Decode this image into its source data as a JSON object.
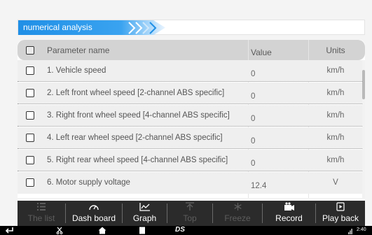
{
  "title": {
    "text": "numerical analysis",
    "accent_color": "#1f8fe6"
  },
  "table": {
    "headers": {
      "name": "Parameter name",
      "value": "Value",
      "units": "Units"
    },
    "rows": [
      {
        "name": "1. Vehicle speed",
        "value": "0",
        "unit": "km/h",
        "checked": false
      },
      {
        "name": "2. Left front wheel speed [2-channel ABS specific]",
        "value": "0",
        "unit": "km/h",
        "checked": false
      },
      {
        "name": "3. Right front wheel speed [4-channel ABS specific]",
        "value": "0",
        "unit": "km/h",
        "checked": false
      },
      {
        "name": "4. Left rear wheel speed [2-channel ABS specific]",
        "value": "0",
        "unit": "km/h",
        "checked": false
      },
      {
        "name": "5. Right rear wheel speed [4-channel ABS specific]",
        "value": "0",
        "unit": "km/h",
        "checked": false
      },
      {
        "name": "6. Motor supply voltage",
        "value": "12.4",
        "unit": "V",
        "checked": false
      }
    ]
  },
  "toolbar": {
    "buttons": [
      {
        "label": "The list",
        "icon": "list-icon",
        "enabled": false
      },
      {
        "label": "Dash board",
        "icon": "gauge-icon",
        "enabled": true
      },
      {
        "label": "Graph",
        "icon": "graph-icon",
        "enabled": true
      },
      {
        "label": "Top",
        "icon": "arrow-top-icon",
        "enabled": false
      },
      {
        "label": "Freeze",
        "icon": "snowflake-icon",
        "enabled": false
      },
      {
        "label": "Record",
        "icon": "camera-icon",
        "enabled": true
      },
      {
        "label": "Play back",
        "icon": "playback-icon",
        "enabled": true
      }
    ]
  },
  "navbar": {
    "logo_text": "DS",
    "time": "2:40"
  }
}
